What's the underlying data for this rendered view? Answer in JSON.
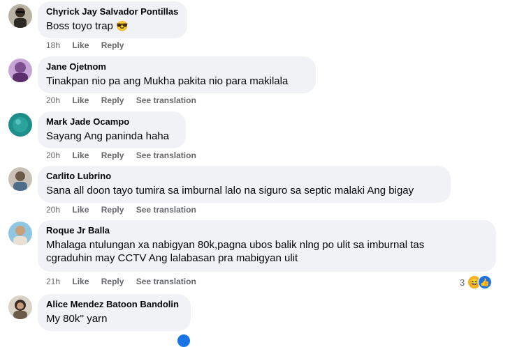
{
  "comments": [
    {
      "author": "Chyrick Jay Salvador Pontillas",
      "text": "Boss toyo trap",
      "emoji": "😎",
      "time": "18h",
      "like": "Like",
      "reply": "Reply"
    },
    {
      "author": "Jane Ojetnom",
      "text": "Tinakpan nio pa ang Mukha pakita nio para makilala",
      "time": "20h",
      "like": "Like",
      "reply": "Reply",
      "translate": "See translation"
    },
    {
      "author": "Mark Jade Ocampo",
      "text": "Sayang Ang paninda haha",
      "time": "20h",
      "like": "Like",
      "reply": "Reply",
      "translate": "See translation"
    },
    {
      "author": "Carlito Lubrino",
      "text": "Sana all doon tayo tumira sa imburnal lalo na siguro sa septic malaki Ang bigay",
      "time": "20h",
      "like": "Like",
      "reply": "Reply",
      "translate": "See translation"
    },
    {
      "author": "Roque Jr Balla",
      "text_line1": "Mhalaga ntulungan xa nabigyan 80k,pagna ubos balik nlng po ulit sa imburnal tas",
      "text_line2": "cgraduhin may CCTV Ang lalabasan pra mabigyan ulit",
      "time": "21h",
      "like": "Like",
      "reply": "Reply",
      "translate": "See translation",
      "reaction_count": "3"
    },
    {
      "author": "Alice Mendez Batoon Bandolin",
      "text": "My 80k'' yarn"
    }
  ],
  "icons": {
    "reaction_haha": "haha-icon",
    "reaction_like": "like-icon"
  },
  "colors": {
    "bubble": "#f0f2f5",
    "meta": "#65676b",
    "like_blue": "#1b74e4",
    "haha_yellow": "#f7b125"
  }
}
